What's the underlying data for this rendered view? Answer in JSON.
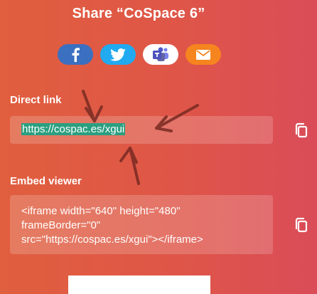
{
  "dialog": {
    "title": "Share “CoSpace 6”"
  },
  "share_buttons": [
    {
      "name": "facebook",
      "color": "#3b6fc0",
      "icon": "facebook-icon"
    },
    {
      "name": "twitter",
      "color": "#21aaf0",
      "icon": "twitter-icon"
    },
    {
      "name": "teams",
      "color": "#ffffff",
      "icon": "microsoft-teams-icon"
    },
    {
      "name": "email",
      "color": "#f6841f",
      "icon": "mail-icon"
    }
  ],
  "direct_link": {
    "label": "Direct link",
    "value": "https://cospac.es/xgui"
  },
  "embed": {
    "label": "Embed viewer",
    "line1": "<iframe width=\"640\" height=\"480\"",
    "line2": "frameBorder=\"0\"",
    "line3": "src=\"https://cospac.es/xgui\"></iframe>"
  },
  "annotation_color": "#7a2a22"
}
